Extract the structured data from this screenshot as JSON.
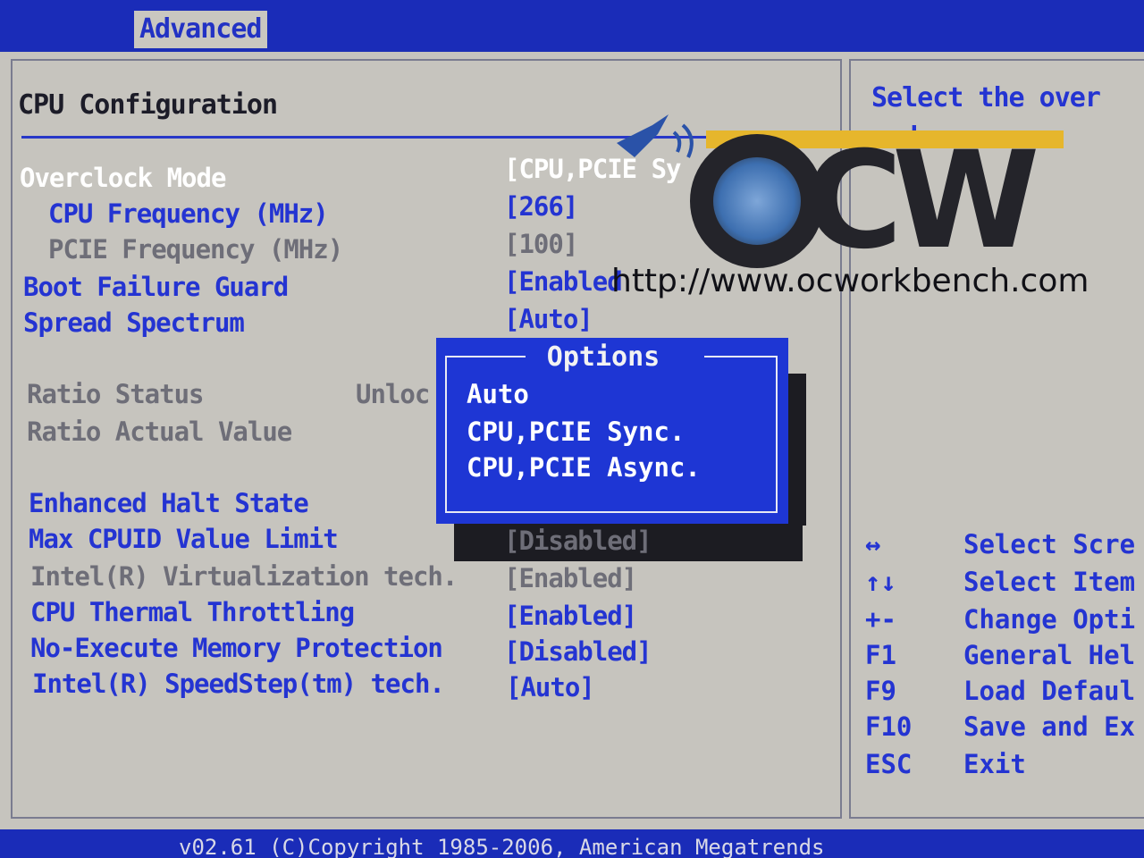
{
  "menu": {
    "active_tab": "Advanced"
  },
  "section": {
    "title": "CPU Configuration"
  },
  "settings": [
    {
      "label": "Overclock Mode",
      "value": "[CPU,PCIE Sy",
      "style": "white"
    },
    {
      "label": "CPU Frequency (MHz)",
      "value": "[266]",
      "style": "blue"
    },
    {
      "label": "PCIE Frequency (MHz)",
      "value": "[100]",
      "style": "grey"
    },
    {
      "label": "Boot Failure Guard",
      "value": "[Enabled",
      "style": "blue"
    },
    {
      "label": "Spread Spectrum",
      "value": "[Auto]",
      "style": "blue"
    },
    {
      "label": "Ratio Status",
      "value": "Unloc",
      "style": "grey"
    },
    {
      "label": "Ratio Actual Value",
      "value": "",
      "style": "grey"
    },
    {
      "label": "Enhanced Halt State",
      "value": "",
      "style": "blue"
    },
    {
      "label": "Max CPUID Value Limit",
      "value": "[Disabled]",
      "style": "blue"
    },
    {
      "label": "Intel(R) Virtualization tech.",
      "value": "[Enabled]",
      "style": "grey"
    },
    {
      "label": "CPU Thermal Throttling",
      "value": "[Enabled]",
      "style": "blue"
    },
    {
      "label": "No-Execute Memory Protection",
      "value": "[Disabled]",
      "style": "blue"
    },
    {
      "label": "Intel(R) SpeedStep(tm) tech.",
      "value": "[Auto]",
      "style": "blue"
    }
  ],
  "options_popup": {
    "title": "Options",
    "items": [
      "Auto",
      "CPU,PCIE Sync.",
      "CPU,PCIE Async."
    ]
  },
  "help": {
    "text": "Select the over mode.",
    "keys": [
      {
        "key": "↔",
        "desc": "Select Scre"
      },
      {
        "key": "↑↓",
        "desc": "Select Item"
      },
      {
        "key": "+-",
        "desc": "Change Opti"
      },
      {
        "key": "F1",
        "desc": "General Hel"
      },
      {
        "key": "F9",
        "desc": "Load Defaul"
      },
      {
        "key": "F10",
        "desc": "Save and Ex"
      },
      {
        "key": "ESC",
        "desc": "Exit"
      }
    ]
  },
  "footer": {
    "copyright": "v02.61 (C)Copyright 1985-2006, American Megatrends"
  },
  "watermark": {
    "letters": "CW",
    "url": "http://www.ocworkbench.com"
  },
  "colors": {
    "bios_blue": "#1c2fb4",
    "panel_grey": "#c6c4be",
    "accent_text": "#2434d2",
    "watermark_gold": "#e6b62c"
  }
}
